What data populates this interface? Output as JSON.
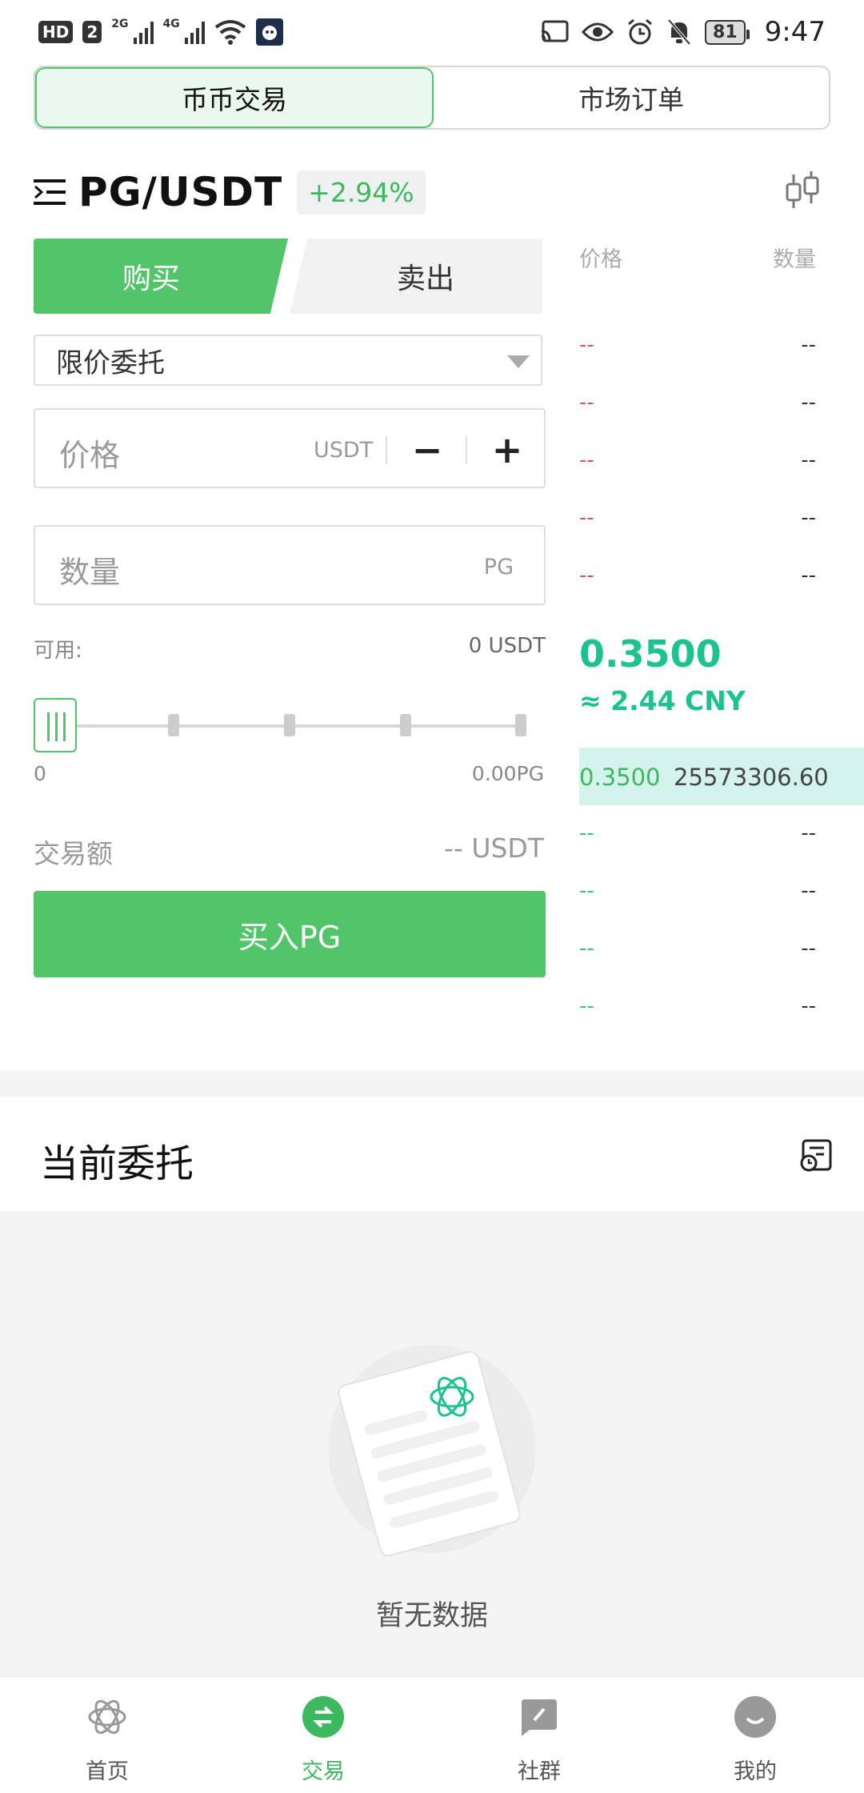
{
  "status_bar": {
    "left_labels": [
      "HD",
      "2",
      "2G",
      "4G"
    ],
    "battery": "81",
    "time": "9:47"
  },
  "top_tabs": [
    {
      "label": "币币交易",
      "active": true
    },
    {
      "label": "市场订单",
      "active": false
    }
  ],
  "pair": {
    "name": "PG/USDT",
    "change": "+2.94%"
  },
  "side_tabs": {
    "buy": "购买",
    "sell": "卖出"
  },
  "order_type": "限价委托",
  "price_input": {
    "placeholder": "价格",
    "unit": "USDT",
    "minus": "−",
    "plus": "+"
  },
  "qty_input": {
    "placeholder": "数量",
    "unit": "PG"
  },
  "available": {
    "label": "可用:",
    "value": "0 USDT"
  },
  "slider": {
    "min_label": "0",
    "max_label": "0.00PG",
    "fraction": 0
  },
  "trade_amount": {
    "label": "交易额",
    "value": "-- USDT"
  },
  "buy_button": "买入PG",
  "order_book": {
    "price_header": "价格",
    "qty_header": "数量",
    "asks": [
      {
        "price": "--",
        "qty": "--"
      },
      {
        "price": "--",
        "qty": "--"
      },
      {
        "price": "--",
        "qty": "--"
      },
      {
        "price": "--",
        "qty": "--"
      },
      {
        "price": "--",
        "qty": "--"
      }
    ],
    "last_price": "0.3500",
    "last_price_cny": "≈ 2.44 CNY",
    "bids": [
      {
        "price": "0.3500",
        "qty": "25573306.60",
        "highlight": true
      },
      {
        "price": "--",
        "qty": "--"
      },
      {
        "price": "--",
        "qty": "--"
      },
      {
        "price": "--",
        "qty": "--"
      },
      {
        "price": "--",
        "qty": "--"
      }
    ]
  },
  "current_orders": {
    "title": "当前委托",
    "empty_text": "暂无数据"
  },
  "bottom_nav": [
    {
      "label": "首页",
      "icon": "home-logo-icon",
      "active": false
    },
    {
      "label": "交易",
      "icon": "trade-exchange-icon",
      "active": true
    },
    {
      "label": "社群",
      "icon": "community-icon",
      "active": false
    },
    {
      "label": "我的",
      "icon": "profile-icon",
      "active": false
    }
  ],
  "colors": {
    "accent": "#52c46a",
    "ask": "#e0525e",
    "bid": "#2ec494",
    "last_price": "#1cc28f"
  }
}
